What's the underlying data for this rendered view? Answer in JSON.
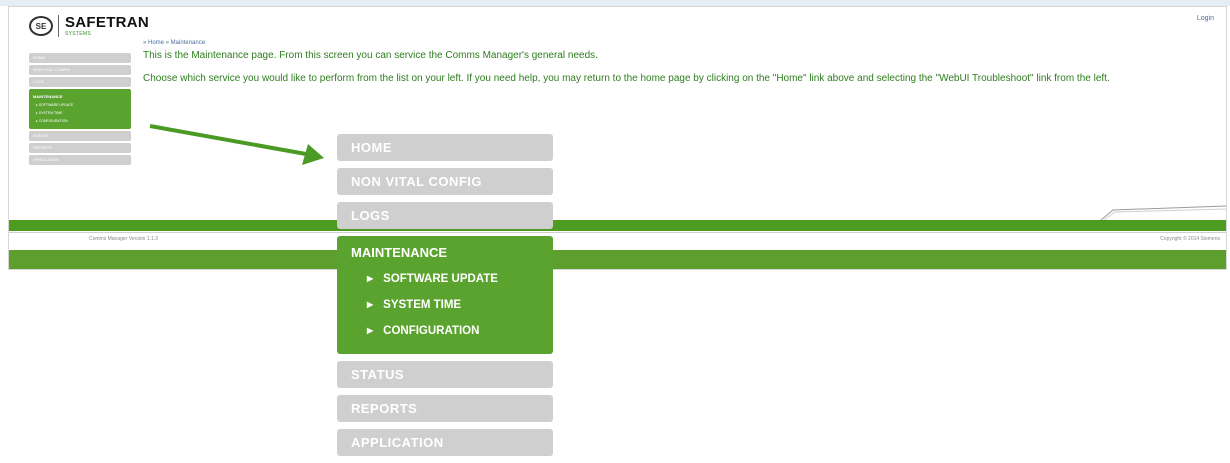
{
  "header": {
    "logo_badge": "SE",
    "logo_text": "SAFETRAN",
    "logo_sub": "SYSTEMS",
    "login": "Login"
  },
  "sidebar_small": {
    "items_top": [
      "HOME",
      "NON VITAL CONFIG",
      "LOGS"
    ],
    "maintenance": "MAINTENANCE",
    "sub_items": [
      "SOFTWARE UPDATE",
      "SYSTEM TIME",
      "CONFIGURATION"
    ],
    "items_bottom": [
      "STATUS",
      "REPORTS",
      "APPLICATION"
    ]
  },
  "main": {
    "breadcrumb": "» Home » Maintenance",
    "intro": "This is the Maintenance page. From this screen you can service the Comms Manager's general needs.",
    "desc": "Choose which service you would like to perform from the list on your left. If you need help, you may return to the home page by clicking on the \"Home\" link above and selecting the \"WebUI Troubleshoot\" link from the left."
  },
  "footer": {
    "version": "Comms Manager Version 1.1.3",
    "copyright": "Copyright © 2014 Siemens"
  },
  "zoom_menu": {
    "items_top": [
      "HOME",
      "NON VITAL CONFIG",
      "LOGS"
    ],
    "maintenance": "MAINTENANCE",
    "sub_items": [
      "SOFTWARE UPDATE",
      "SYSTEM TIME",
      "CONFIGURATION"
    ],
    "items_bottom": [
      "STATUS",
      "REPORTS",
      "APPLICATION"
    ]
  },
  "colors": {
    "accent_green": "#5aa32e",
    "text_green": "#2e7d1e",
    "inactive_gray": "#cfcfcf",
    "arrow_green": "#4a9a24"
  },
  "icons": [
    "safetran-logo",
    "triangle-right-icon",
    "pointer-arrow"
  ]
}
